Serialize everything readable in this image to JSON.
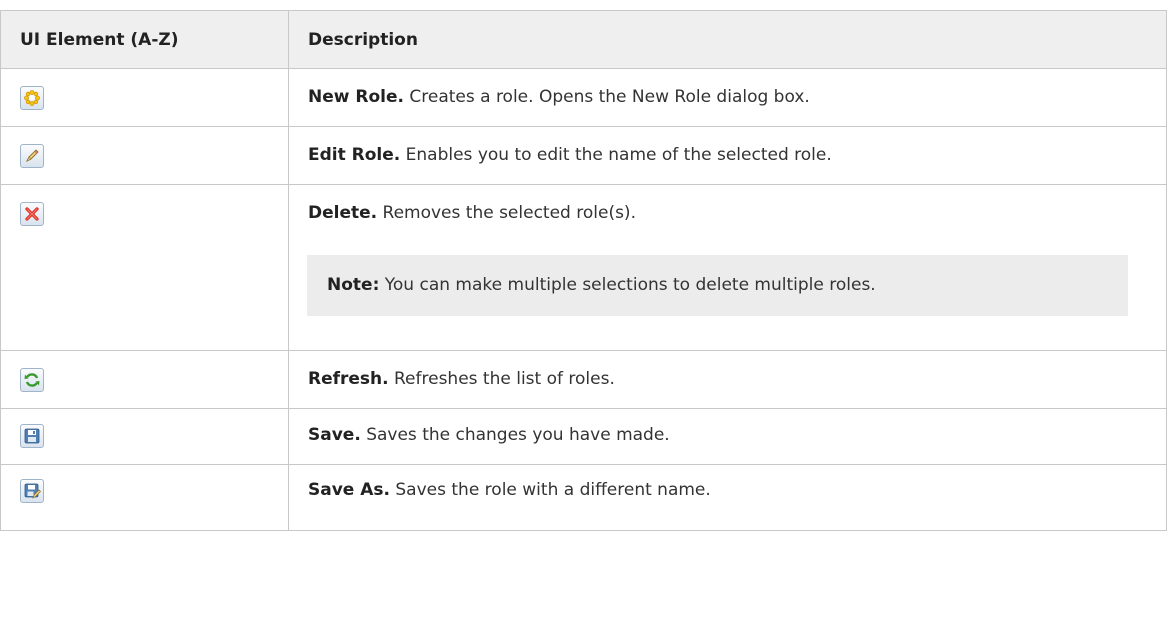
{
  "table": {
    "headers": {
      "element": "UI Element (A-Z)",
      "description": "Description"
    },
    "rows": [
      {
        "icon": "new-role-icon",
        "term": "New Role.",
        "text": " Creates a role. Opens the New Role dialog box."
      },
      {
        "icon": "edit-role-icon",
        "term": "Edit Role.",
        "text": " Enables you to edit the name of the selected role."
      },
      {
        "icon": "delete-icon",
        "term": "Delete.",
        "text": " Removes the selected role(s).",
        "note": {
          "label": "Note:",
          "text": " You can make multiple selections to delete multiple roles."
        }
      },
      {
        "icon": "refresh-icon",
        "term": "Refresh.",
        "text": " Refreshes the list of roles."
      },
      {
        "icon": "save-icon",
        "term": "Save.",
        "text": " Saves the changes you have made."
      },
      {
        "icon": "save-as-icon",
        "term": "Save As.",
        "text": " Saves the role with a different name."
      }
    ]
  }
}
